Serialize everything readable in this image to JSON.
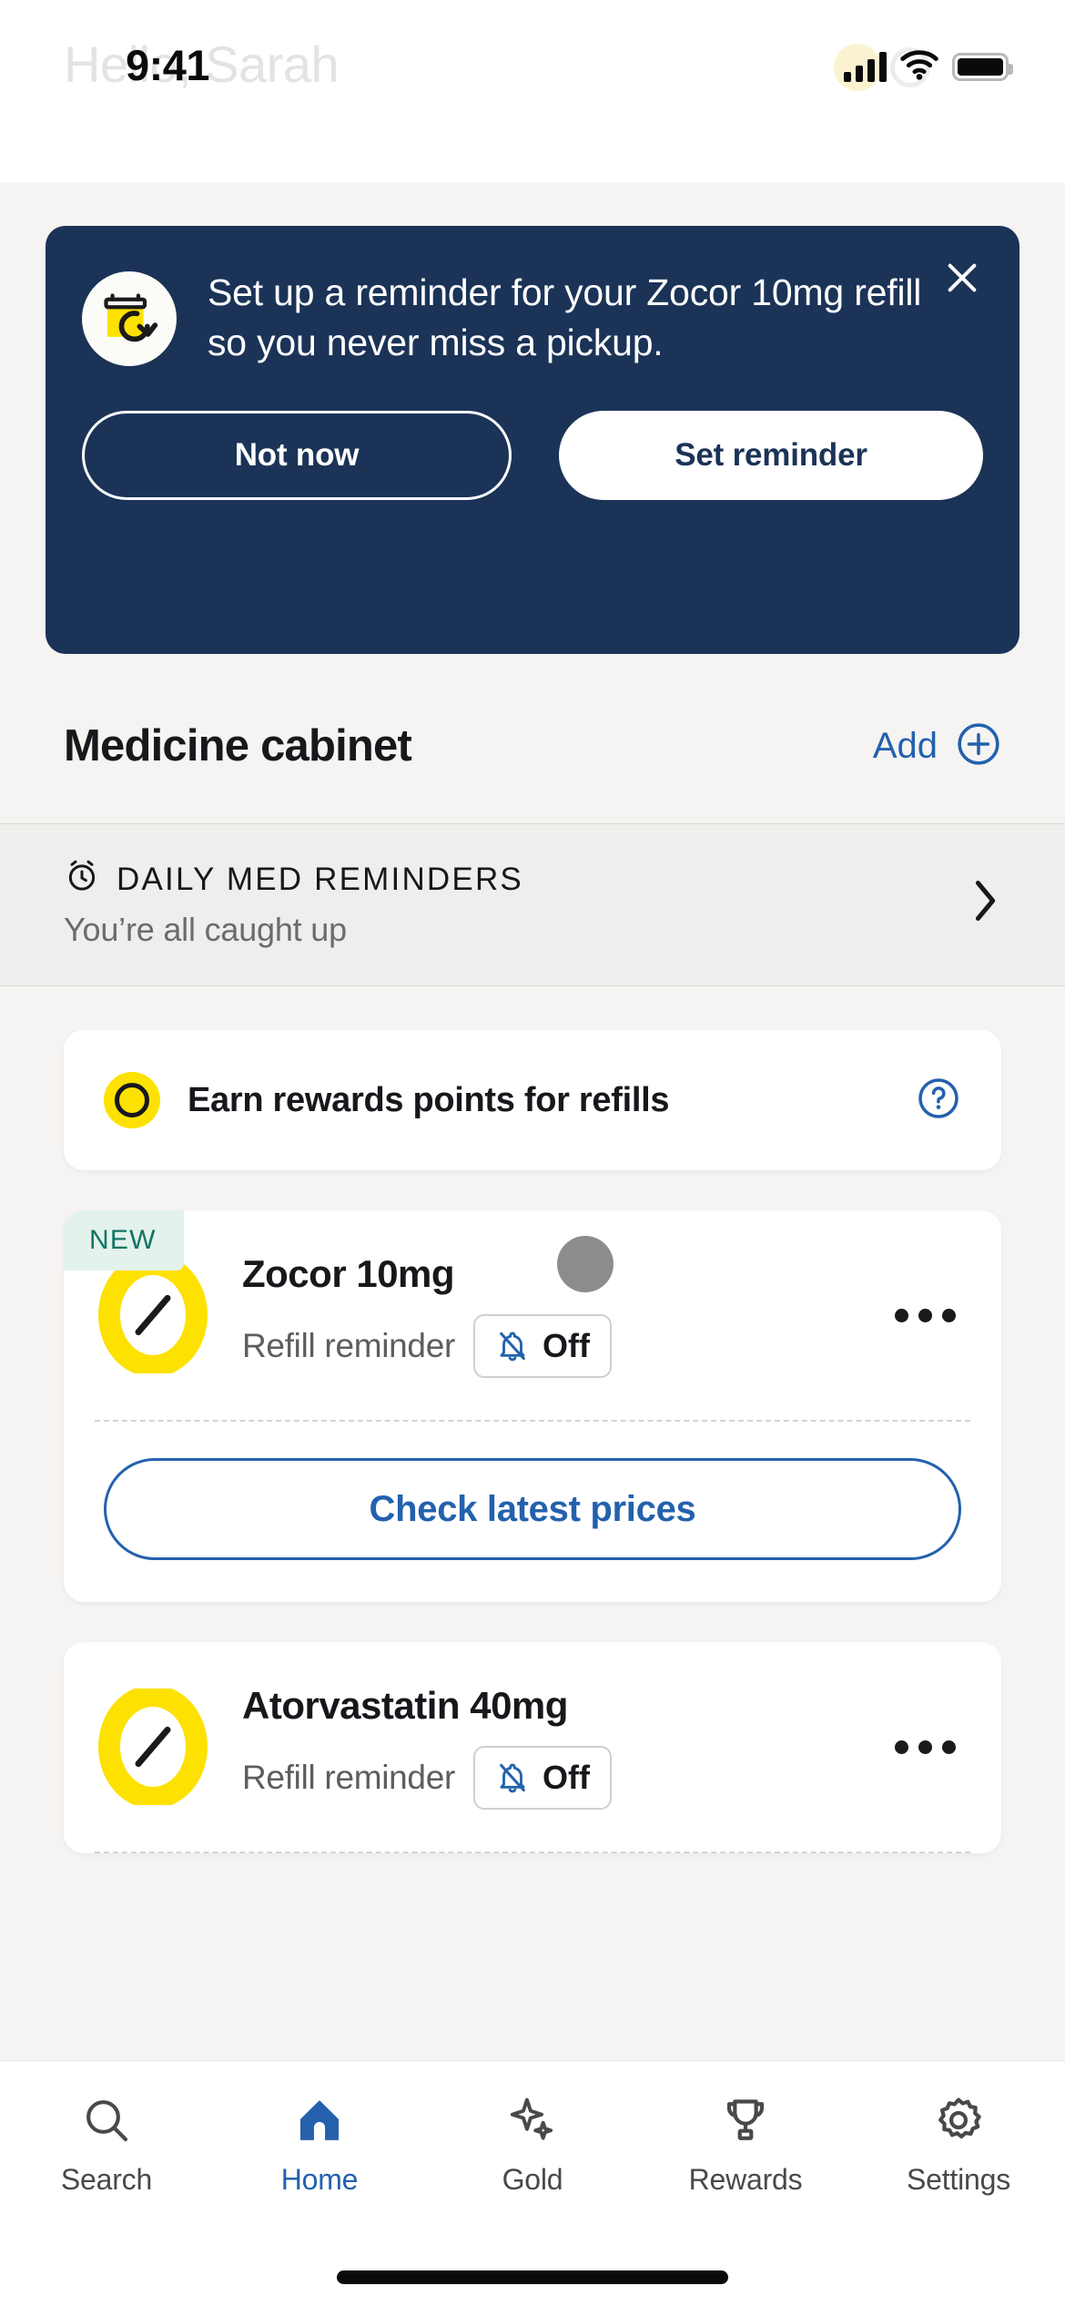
{
  "status_bar": {
    "time": "9:41",
    "icons": [
      "signal-bars",
      "wifi",
      "battery"
    ]
  },
  "header": {
    "greeting": "Hello, Sarah"
  },
  "banner": {
    "message": "Set up a reminder for your Zocor 10mg refill so you never miss a pickup.",
    "close_label": "×",
    "secondary_button": "Not now",
    "primary_button": "Set reminder",
    "icon": "pill-bottle-refresh-icon",
    "background_color": "#1B3357"
  },
  "medicine_cabinet": {
    "title": "Medicine cabinet",
    "add_label": "Add",
    "add_icon": "plus-circle-icon"
  },
  "daily_reminders": {
    "icon": "alarm-clock-icon",
    "title": "DAILY MED REMINDERS",
    "subtitle": "You’re all caught up",
    "chevron": "chevron-right-icon"
  },
  "rewards_banner": {
    "icon": "coin-icon",
    "text": "Earn rewards points for refills",
    "help_icon": "question-circle-icon"
  },
  "medications": [
    {
      "badge": "NEW",
      "name": "Zocor 10mg",
      "reminder_label": "Refill reminder",
      "reminder_state": "Off",
      "reminder_icon": "bell-off-icon",
      "menu_icon": "kebab-menu-icon",
      "pill_icon": "pill-capsule-icon",
      "cta": "Check latest prices",
      "has_avatar_dot": true
    },
    {
      "badge": null,
      "name": "Atorvastatin 40mg",
      "reminder_label": "Refill reminder",
      "reminder_state": "Off",
      "reminder_icon": "bell-off-icon",
      "menu_icon": "kebab-menu-icon",
      "pill_icon": "pill-capsule-icon",
      "cta": null,
      "has_avatar_dot": false
    }
  ],
  "tabbar": {
    "items": [
      {
        "label": "Search",
        "icon": "search-icon",
        "active": false
      },
      {
        "label": "Home",
        "icon": "home-icon",
        "active": true
      },
      {
        "label": "Gold",
        "icon": "sparkle-icon",
        "active": false
      },
      {
        "label": "Rewards",
        "icon": "trophy-icon",
        "active": false
      },
      {
        "label": "Settings",
        "icon": "gear-icon",
        "active": false
      }
    ]
  },
  "colors": {
    "navy": "#1B3357",
    "blue": "#2361AD",
    "yellow": "#FDE100",
    "badge_green_text": "#0E7560",
    "badge_green_bg": "#E3F2EC",
    "page_bg": "#F5F4F2"
  }
}
